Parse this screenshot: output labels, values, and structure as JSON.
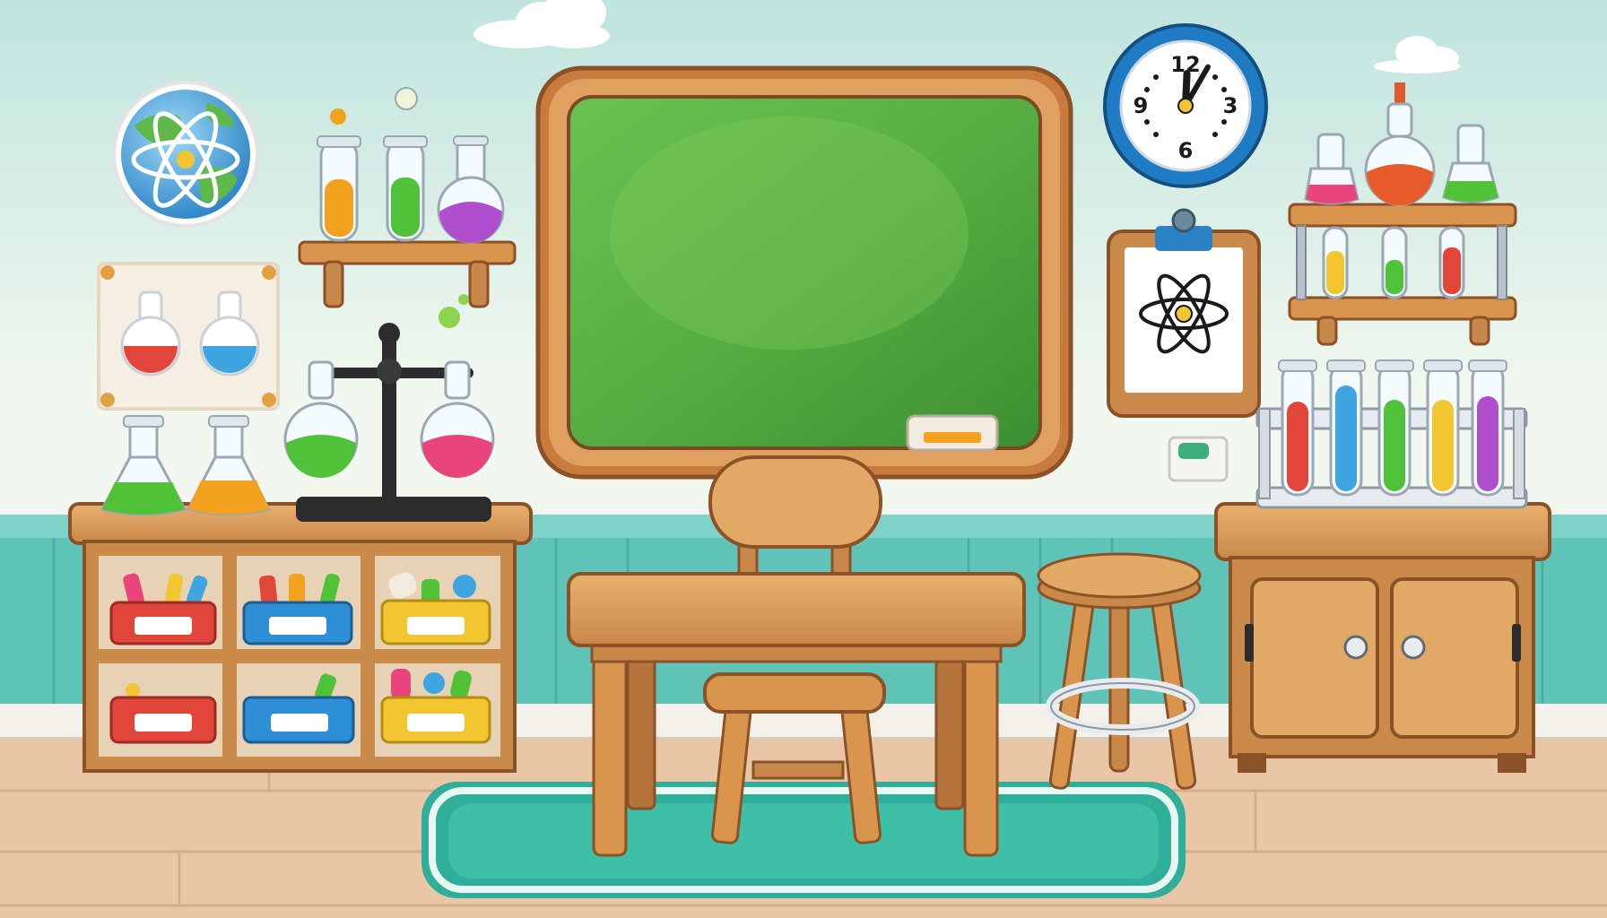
{
  "scene": {
    "clock": {
      "numerals": [
        "12",
        "3",
        "6",
        "9"
      ],
      "time_shown": {
        "hour": 12,
        "minute": 5
      }
    },
    "blackboard": {
      "text": ""
    },
    "colors": {
      "wall_top": "#cfe9e3",
      "wall_mid": "#eef6ee",
      "wainscot": "#5fc3b8",
      "floor": "#e6c2a4",
      "board_green": "#52a83f",
      "wood": "#c98a4a",
      "wood_light": "#e2a866",
      "wood_dark": "#8b5127",
      "rug": "#3dbfa8",
      "clock_ring": "#1e7bc4",
      "liquid_red": "#e2453a",
      "liquid_blue": "#3fa5e0",
      "liquid_green": "#4fc23a",
      "liquid_orange": "#f3a21f",
      "liquid_purple": "#b04fce",
      "liquid_pink": "#e9457c",
      "liquid_yellow": "#f2c531"
    },
    "icons": [
      "atom-icon",
      "globe-icon",
      "clock-icon",
      "flask-icon",
      "test-tube-icon",
      "cloud-icon"
    ]
  }
}
